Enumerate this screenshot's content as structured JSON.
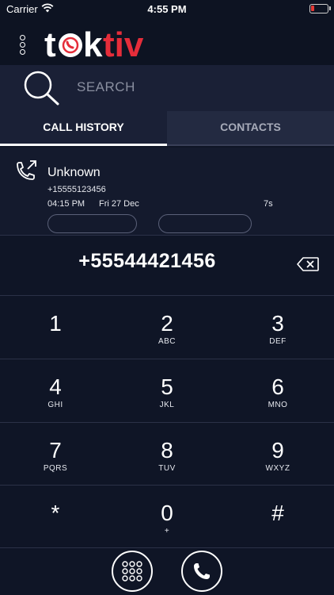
{
  "status_bar": {
    "carrier": "Carrier",
    "time": "4:55 PM",
    "battery_fraction": 0.15
  },
  "header": {
    "logo_text": "toktiv",
    "menu_icon": "vertical-dots-icon"
  },
  "search": {
    "label": "SEARCH",
    "icon": "search-icon"
  },
  "tabs": [
    {
      "label": "CALL HISTORY",
      "active": true
    },
    {
      "label": "CONTACTS",
      "active": false
    }
  ],
  "call_history": [
    {
      "name": "Unknown",
      "number": "+15555123456",
      "time": "04:15 PM",
      "date": "Fri 27 Dec",
      "duration": "7s",
      "icon": "outgoing-call-icon"
    }
  ],
  "dialer": {
    "number": "+55544421456",
    "keys": [
      {
        "digit": "1",
        "letters": ""
      },
      {
        "digit": "2",
        "letters": "ABC"
      },
      {
        "digit": "3",
        "letters": "DEF"
      },
      {
        "digit": "4",
        "letters": "GHI"
      },
      {
        "digit": "5",
        "letters": "JKL"
      },
      {
        "digit": "6",
        "letters": "MNO"
      },
      {
        "digit": "7",
        "letters": "PQRS"
      },
      {
        "digit": "8",
        "letters": "TUV"
      },
      {
        "digit": "9",
        "letters": "WXYZ"
      },
      {
        "digit": "*",
        "letters": ""
      },
      {
        "digit": "0",
        "letters": "+"
      },
      {
        "digit": "#",
        "letters": ""
      }
    ]
  },
  "colors": {
    "background": "#0f1526",
    "accent_red": "#e52d3a",
    "tab_bar": "#232a41"
  }
}
